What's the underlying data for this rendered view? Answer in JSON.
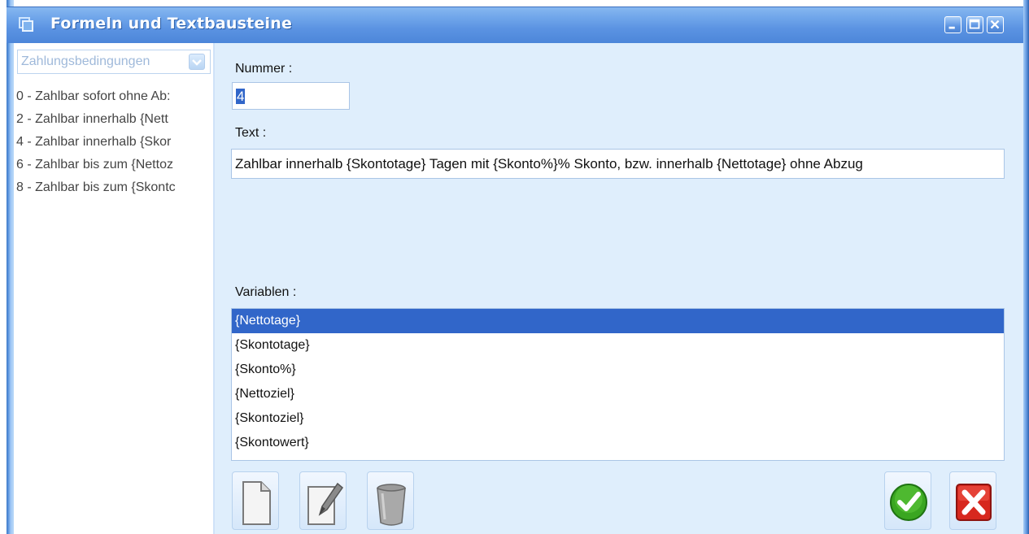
{
  "window": {
    "title": "Formeln und Textbausteine",
    "icons": {
      "app": "window-icon",
      "minimize": "minimize-icon",
      "maximize": "maximize-icon",
      "close": "close-icon"
    }
  },
  "sidebar": {
    "category_select": {
      "value": "Zahlungsbedingungen"
    },
    "items": [
      {
        "label": "0 - Zahlbar sofort ohne Ab:"
      },
      {
        "label": "2 - Zahlbar innerhalb {Nett"
      },
      {
        "label": "4 - Zahlbar innerhalb {Skor"
      },
      {
        "label": "6 - Zahlbar bis zum {Nettoz"
      },
      {
        "label": "8 - Zahlbar bis zum {Skontc"
      }
    ]
  },
  "form": {
    "nummer_label": "Nummer :",
    "nummer_value": "4",
    "text_label": "Text :",
    "text_value": "Zahlbar innerhalb {Skontotage} Tagen mit {Skonto%}% Skonto, bzw. innerhalb {Nettotage} ohne Abzug",
    "variables_label": "Variablen :",
    "variables": [
      {
        "label": "{Nettotage}",
        "selected": true
      },
      {
        "label": "{Skontotage}"
      },
      {
        "label": "{Skonto%}"
      },
      {
        "label": "{Nettoziel}"
      },
      {
        "label": "{Skontoziel}"
      },
      {
        "label": "{Skontowert}"
      }
    ]
  },
  "toolbar": {
    "new_icon": "new-document-icon",
    "edit_icon": "edit-pencil-icon",
    "delete_icon": "trash-icon",
    "ok_icon": "checkmark-icon",
    "cancel_icon": "close-x-icon"
  },
  "colors": {
    "titlebar": "#5b93e2",
    "client_background": "#dfeefc",
    "selection": "#3166c9",
    "ok_green": "#3aa621",
    "cancel_red": "#d7281e"
  }
}
